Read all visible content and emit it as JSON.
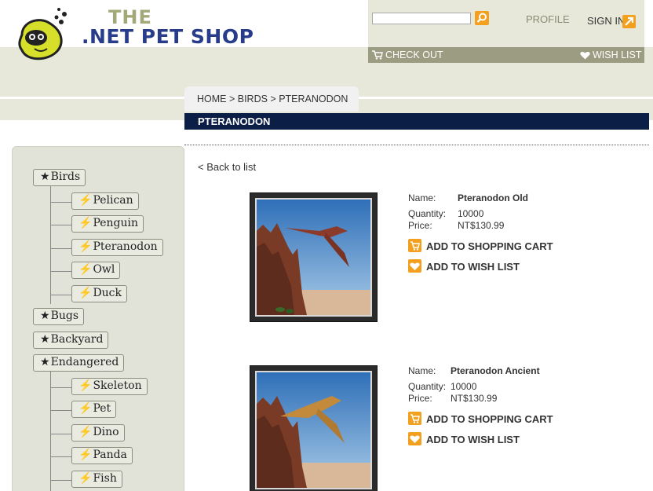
{
  "header": {
    "logo_word_the": "THE",
    "logo_title": ".NET PET SHOP",
    "search": {
      "value": "",
      "placeholder": ""
    },
    "profile_label": "PROFILE",
    "signin_label": "SIGN IN",
    "checkout_label": "CHECK OUT",
    "wishlist_label": "WISH LIST"
  },
  "breadcrumb": "HOME > BIRDS > PTERANODON",
  "page_title": "PTERANODON",
  "back_label": "< Back to list",
  "sidebar": {
    "tree": [
      {
        "label": "Birds",
        "children": [
          "Pelican",
          "Penguin",
          "Pteranodon",
          "Owl",
          "Duck"
        ]
      },
      {
        "label": "Bugs",
        "children": []
      },
      {
        "label": "Backyard",
        "children": []
      },
      {
        "label": "Endangered",
        "children": [
          "Skeleton",
          "Pet",
          "Dino",
          "Panda",
          "Fish"
        ]
      }
    ]
  },
  "products": [
    {
      "name_label": "Name:",
      "name": "Pteranodon Old",
      "qty_label": "Quantity:",
      "quantity": "10000",
      "price_label": "Price:",
      "price": "NT$130.99",
      "cart_label": "ADD TO SHOPPING CART",
      "wish_label": "ADD TO WISH LIST"
    },
    {
      "name_label": "Name:",
      "name": "Pteranodon Ancient",
      "qty_label": "Quantity:",
      "quantity": "10000",
      "price_label": "Price:",
      "price": "NT$130.99",
      "cart_label": "ADD TO SHOPPING CART",
      "wish_label": "ADD TO WISH LIST"
    }
  ],
  "colors": {
    "accent": "#f2a01e",
    "navy": "#0b1e46",
    "band": "#e7e8da",
    "bar": "#9b9c81"
  }
}
